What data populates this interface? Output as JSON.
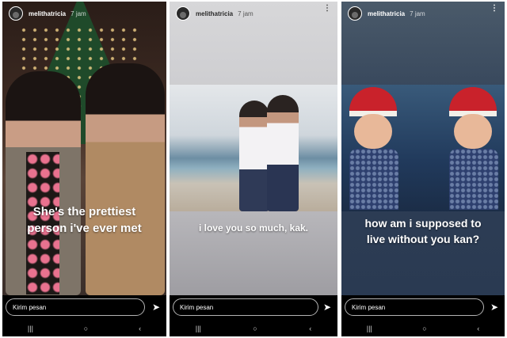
{
  "stories": [
    {
      "username": "melithatricia",
      "time": "7 jam",
      "caption_lines": [
        "She's the prettiest",
        "person i've ever met"
      ],
      "message_placeholder": "Kirim pesan"
    },
    {
      "username": "melithatricia",
      "time": "7 jam",
      "caption_lines": [
        "i love you so much, kak."
      ],
      "message_placeholder": "Kirim pesan"
    },
    {
      "username": "melithatricia",
      "time": "7 jam",
      "caption_lines": [
        "how am i supposed to",
        "live without you kan?"
      ],
      "message_placeholder": "Kirim pesan"
    }
  ],
  "icons": {
    "avatar": "profile-avatar",
    "more": "more-vertical-icon",
    "send": "send-arrow-icon",
    "nav": [
      "recent-apps-icon",
      "home-icon",
      "back-icon"
    ]
  },
  "nav_glyphs": [
    "|||",
    "○",
    "‹"
  ],
  "more_glyph": "⋮",
  "send_glyph": "➤"
}
